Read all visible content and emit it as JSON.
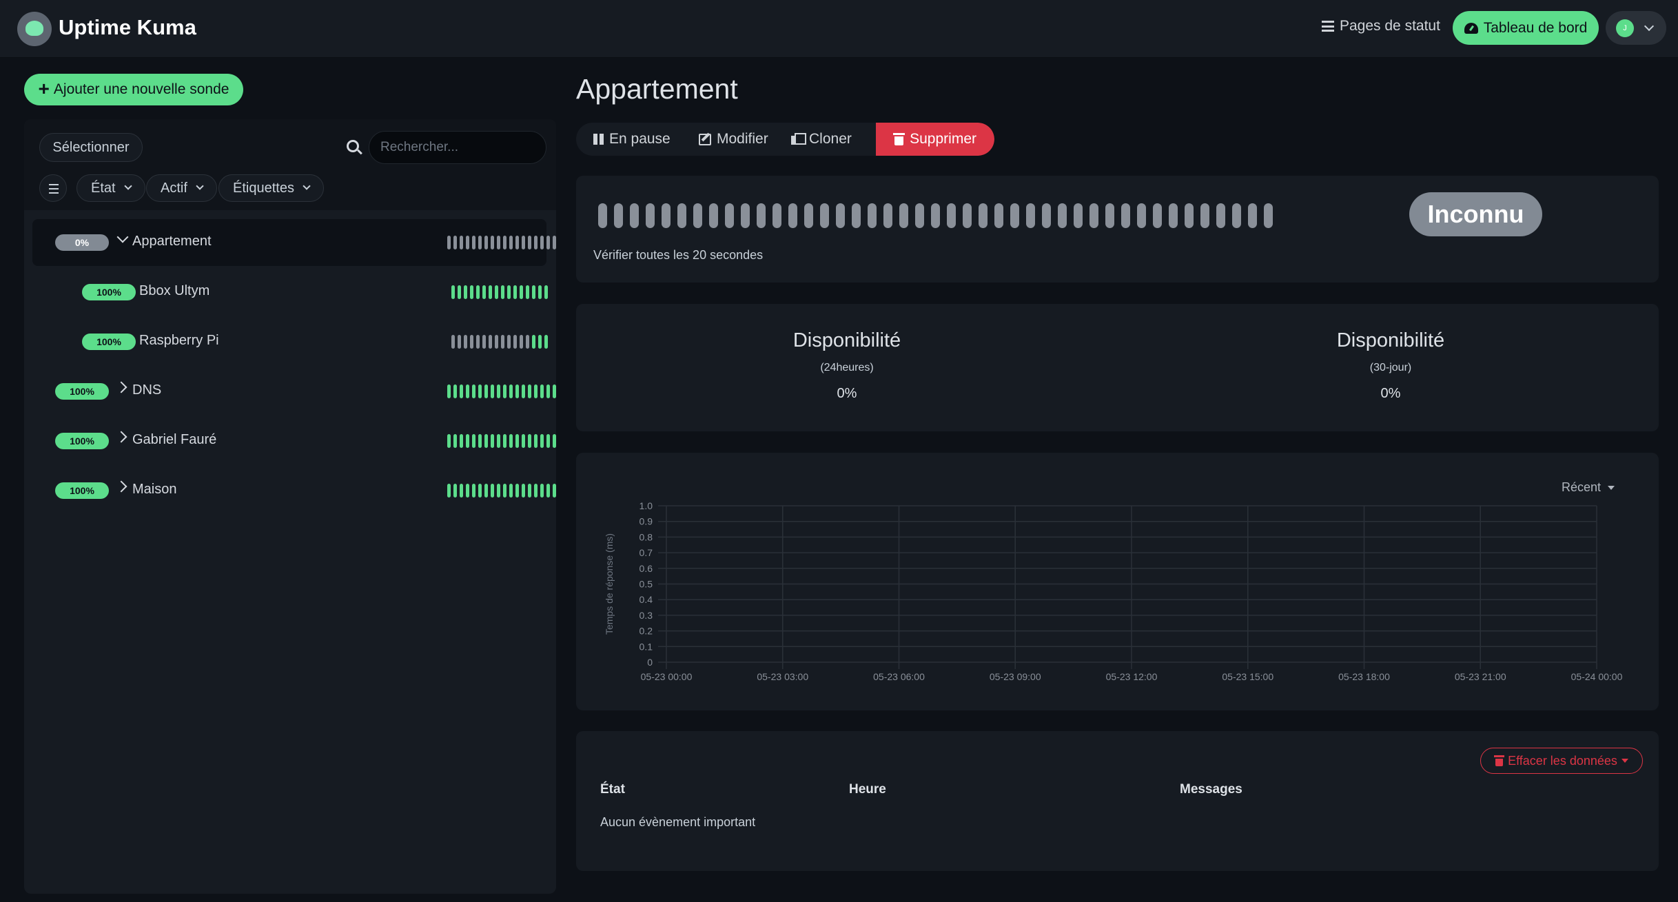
{
  "header": {
    "brand": "Uptime Kuma",
    "status_pages": "Pages de statut",
    "dashboard": "Tableau de bord",
    "avatar_initial": "J"
  },
  "sidebar": {
    "add_button": "Ajouter une nouvelle sonde",
    "select_label": "Sélectionner",
    "search_placeholder": "Rechercher...",
    "filters": [
      "État",
      "Actif",
      "Étiquettes"
    ],
    "monitors": [
      {
        "name": "Appartement",
        "uptime": "0%",
        "expanded": true,
        "child": false,
        "heartbeats": "kkkkkkkkkkkkkkkkkk"
      },
      {
        "name": "Bbox Ultym",
        "uptime": "100%",
        "child": true,
        "heartbeats": "gggggggggggggggg"
      },
      {
        "name": "Raspberry Pi",
        "uptime": "100%",
        "child": true,
        "heartbeats": "kkkkkkkkkkkkkggg"
      },
      {
        "name": "DNS",
        "uptime": "100%",
        "expanded": false,
        "child": false,
        "heartbeats": "gggggggggggggggggg"
      },
      {
        "name": "Gabriel Fauré",
        "uptime": "100%",
        "expanded": false,
        "child": false,
        "heartbeats": "gggggggggggggggggg"
      },
      {
        "name": "Maison",
        "uptime": "100%",
        "expanded": false,
        "child": false,
        "heartbeats": "gggggggggggggggggg"
      }
    ]
  },
  "monitor": {
    "title": "Appartement",
    "actions": {
      "pause": "En pause",
      "edit": "Modifier",
      "clone": "Cloner",
      "delete": "Supprimer"
    },
    "status": "Inconnu",
    "interval_text": "Vérifier toutes les 20 secondes",
    "uptime_24h": {
      "label": "Disponibilité",
      "period": "(24heures)",
      "value": "0%"
    },
    "uptime_30d": {
      "label": "Disponibilité",
      "period": "(30-jour)",
      "value": "0%"
    },
    "chart_range": "Récent",
    "clear_data": "Effacer les données",
    "events_table": {
      "headers": [
        "État",
        "Heure",
        "Messages"
      ],
      "empty": "Aucun évènement important"
    }
  },
  "colors": {
    "accent": "#5cdd8b",
    "danger": "#dc3545",
    "unknown": "#828a94",
    "background": "#0d1117",
    "panel": "#161b22"
  },
  "chart_data": {
    "type": "line",
    "title": "",
    "xlabel": "",
    "ylabel": "Temps de réponse (ms)",
    "ylim": [
      0,
      1
    ],
    "yticks": [
      "0",
      "0.1",
      "0.2",
      "0.3",
      "0.4",
      "0.5",
      "0.6",
      "0.7",
      "0.8",
      "0.9",
      "1.0"
    ],
    "xticks": [
      "05-23 00:00",
      "05-23 03:00",
      "05-23 06:00",
      "05-23 09:00",
      "05-23 12:00",
      "05-23 15:00",
      "05-23 18:00",
      "05-23 21:00",
      "05-24 00:00"
    ],
    "series": [],
    "grid": true
  }
}
